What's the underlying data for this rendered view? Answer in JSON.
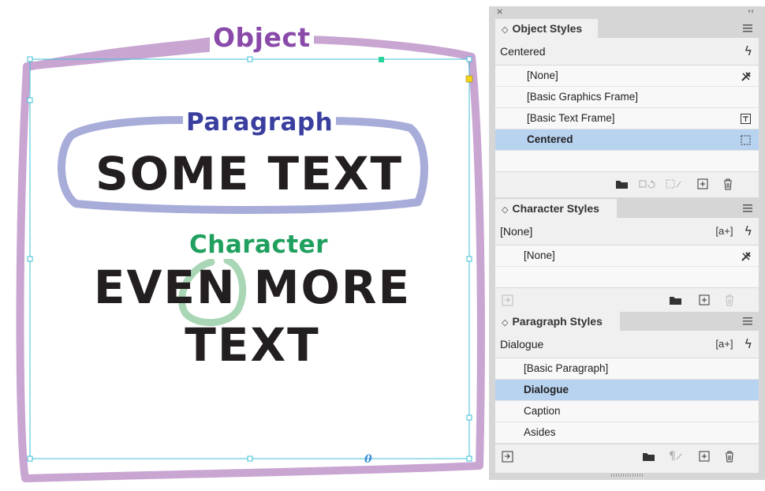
{
  "canvas": {
    "label_object": "Object",
    "label_paragraph": "Paragraph",
    "label_character": "Character",
    "text_line_1": "SOME TEXT",
    "text_line_2": "EVEN MORE",
    "text_line_3": "TEXT",
    "colors": {
      "object": "#c9a5d2",
      "paragraph": "#a7acd9",
      "character": "#a9d6b5",
      "frame": "#3dbfd6",
      "text": "#231f20"
    }
  },
  "panel_chrome": {
    "close_icon": "close-icon",
    "collapse_glyph": "‹‹",
    "close_glyph": "×"
  },
  "object_styles": {
    "tab_label": "Object Styles",
    "current_style": "Centered",
    "items": [
      {
        "label": "[None]",
        "icon": "clear-overrides-icon"
      },
      {
        "label": "[Basic Graphics Frame]",
        "icon": ""
      },
      {
        "label": "[Basic Text Frame]",
        "icon": "text-frame-icon"
      },
      {
        "label": "Centered",
        "icon": "frame-icon",
        "selected": true
      }
    ]
  },
  "character_styles": {
    "tab_label": "Character Styles",
    "current_style": "[None]",
    "aplus": "[a+]",
    "items": [
      {
        "label": "[None]",
        "icon": "clear-overrides-icon"
      }
    ]
  },
  "paragraph_styles": {
    "tab_label": "Paragraph Styles",
    "current_style": "Dialogue",
    "aplus": "[a+]",
    "items": [
      {
        "label": "[Basic Paragraph]"
      },
      {
        "label": "Dialogue",
        "selected": true
      },
      {
        "label": "Caption"
      },
      {
        "label": "Asides"
      }
    ]
  },
  "glyphs": {
    "lightning": "ϟ",
    "arrows": "◇",
    "pilcrow": "¶"
  }
}
